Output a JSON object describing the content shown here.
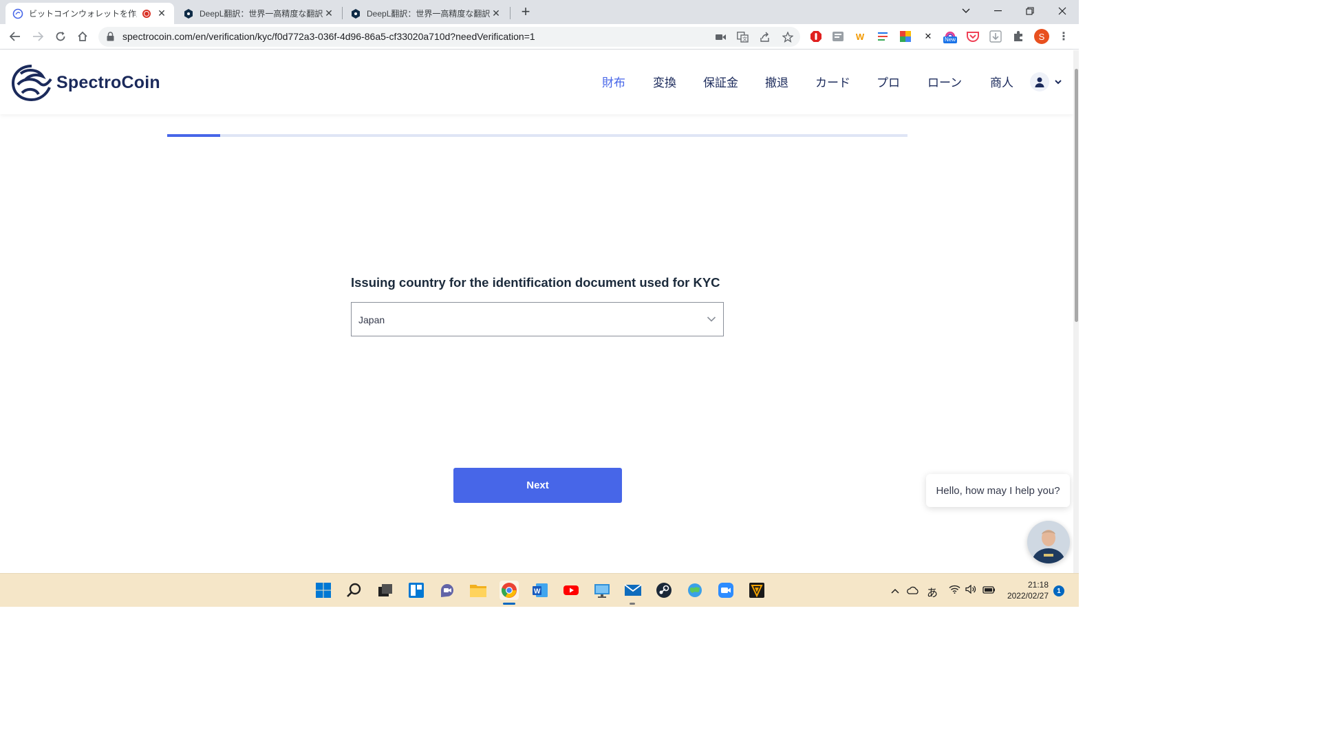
{
  "browser": {
    "tabs": [
      {
        "title": "ビットコインウォレットを作成する|",
        "active": true,
        "recording": true
      },
      {
        "title": "DeepL翻訳：世界一高精度な翻訳",
        "active": false
      },
      {
        "title": "DeepL翻訳：世界一高精度な翻訳",
        "active": false
      }
    ],
    "url": "spectrocoin.com/en/verification/kyc/f0d772a3-036f-4d96-86a5-cf33020a710d?needVerification=1",
    "extensions": {
      "w_label": "W",
      "new_badge": "New",
      "profile_initial": "S"
    }
  },
  "site": {
    "brand": "SpectroCoin",
    "menu": [
      {
        "label": "財布",
        "active": true
      },
      {
        "label": "変換",
        "active": false
      },
      {
        "label": "保証金",
        "active": false
      },
      {
        "label": "撤退",
        "active": false
      },
      {
        "label": "カード",
        "active": false
      },
      {
        "label": "プロ",
        "active": false
      },
      {
        "label": "ローン",
        "active": false
      },
      {
        "label": "商人",
        "active": false
      }
    ],
    "accent_color": "#4766e8",
    "brand_color": "#1b2a5b"
  },
  "kyc": {
    "progress_fraction": 0.072,
    "question": "Issuing country for the identification document used for KYC",
    "country_selected": "Japan",
    "next_label": "Next"
  },
  "chat": {
    "message": "Hello, how may I help you?"
  },
  "taskbar": {
    "apps": [
      "start-icon",
      "search-icon",
      "task-view-icon",
      "widgets-icon",
      "teams-chat-icon",
      "file-explorer-icon",
      "chrome-icon",
      "word-icon",
      "youtube-icon",
      "remote-desktop-icon",
      "mail-icon",
      "steam-icon",
      "game-icon",
      "zoom-icon",
      "vpn-icon"
    ],
    "ime": "あ",
    "time": "21:18",
    "date": "2022/02/27",
    "notifications": "1"
  }
}
